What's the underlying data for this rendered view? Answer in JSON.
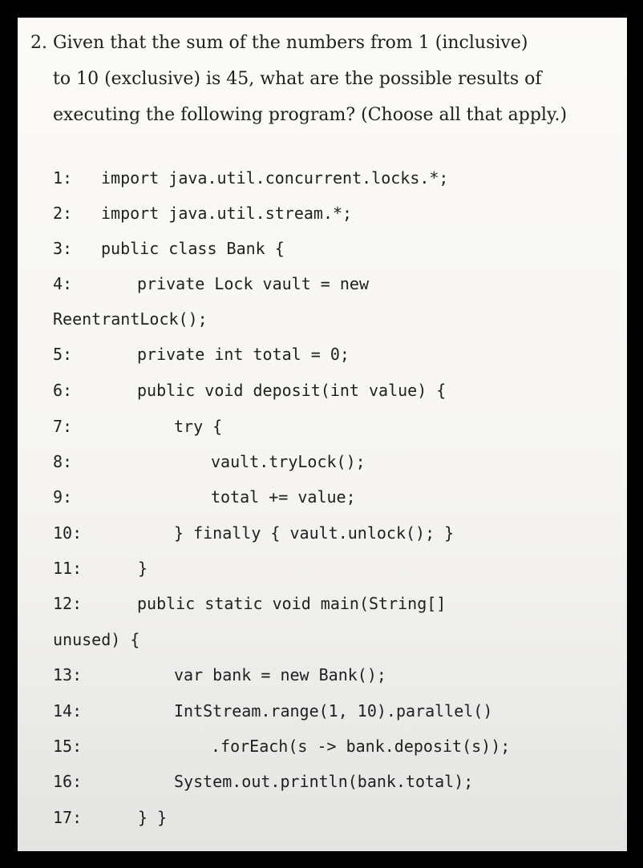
{
  "question": {
    "number": "2.",
    "line1": "Given that the sum of the numbers from 1 (inclusive)",
    "line2": "to 10 (exclusive) is 45, what are the possible results of",
    "line3": "executing the following program? (Choose all that apply.)"
  },
  "code": [
    {
      "num": "1:",
      "text": "import java.util.concurrent.locks.*;"
    },
    {
      "num": "2:",
      "text": "import java.util.stream.*;"
    },
    {
      "num": "3:",
      "text": "public class Bank {"
    },
    {
      "num": "4:",
      "text": "private Lock vault = new"
    },
    {
      "num": "",
      "text": "ReentrantLock();"
    },
    {
      "num": "5:",
      "text": "private int total = 0;"
    },
    {
      "num": "6:",
      "text": "public void deposit(int value) {"
    },
    {
      "num": "7:",
      "text": "try {"
    },
    {
      "num": "8:",
      "text": "vault.tryLock();"
    },
    {
      "num": "9:",
      "text": "total += value;"
    },
    {
      "num": "10:",
      "text": "} finally { vault.unlock(); }"
    },
    {
      "num": "11:",
      "text": "}"
    },
    {
      "num": "12:",
      "text": "public static void main(String[]"
    },
    {
      "num": "",
      "text": "unused) {"
    },
    {
      "num": "13:",
      "text": "var bank = new Bank();"
    },
    {
      "num": "14:",
      "text": "IntStream.range(1, 10).parallel()"
    },
    {
      "num": "15:",
      "text": ".forEach(s -> bank.deposit(s));"
    },
    {
      "num": "16:",
      "text": "System.out.println(bank.total);"
    },
    {
      "num": "17:",
      "text": "} }"
    }
  ]
}
